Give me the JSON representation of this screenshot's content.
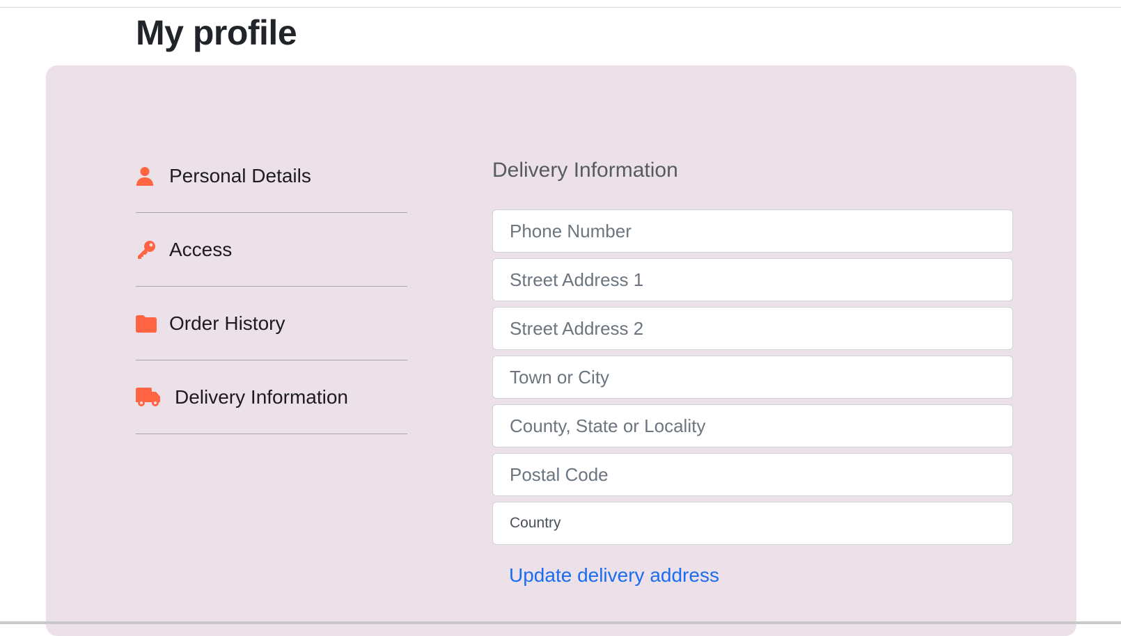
{
  "page": {
    "title": "My profile"
  },
  "sidebar": {
    "items": [
      {
        "label": "Personal Details",
        "icon": "user-icon"
      },
      {
        "label": "Access",
        "icon": "key-icon"
      },
      {
        "label": "Order History",
        "icon": "folder-icon"
      },
      {
        "label": "Delivery Information",
        "icon": "truck-icon"
      }
    ]
  },
  "form": {
    "title": "Delivery Information",
    "fields": {
      "phone": {
        "placeholder": "Phone Number",
        "value": ""
      },
      "street1": {
        "placeholder": "Street Address 1",
        "value": ""
      },
      "street2": {
        "placeholder": "Street Address 2",
        "value": ""
      },
      "town": {
        "placeholder": "Town or City",
        "value": ""
      },
      "county": {
        "placeholder": "County, State or Locality",
        "value": ""
      },
      "postal": {
        "placeholder": "Postal Code",
        "value": ""
      },
      "country": {
        "selected": "Country"
      }
    },
    "submit_label": "Update delivery address"
  },
  "colors": {
    "accent": "#ff6543",
    "panel_bg": "#ece1e9",
    "link": "#1a6cf0"
  }
}
